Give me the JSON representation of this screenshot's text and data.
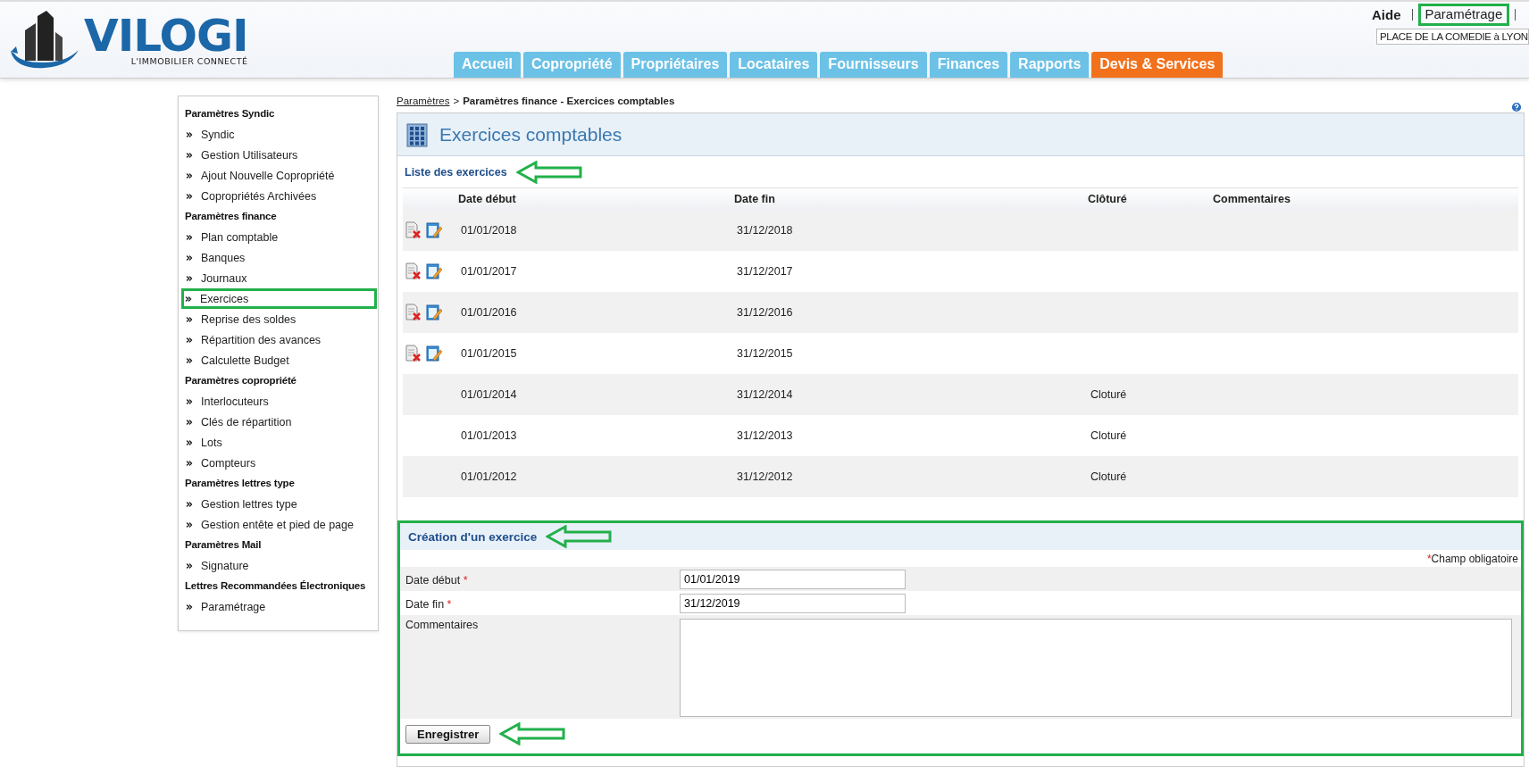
{
  "header": {
    "logo": {
      "name": "VILOGI",
      "tagline": "L'IMMOBILIER CONNECTÉ"
    },
    "nav_tabs": [
      {
        "label": "Accueil",
        "kind": "normal"
      },
      {
        "label": "Copropriété",
        "kind": "normal"
      },
      {
        "label": "Propriétaires",
        "kind": "normal"
      },
      {
        "label": "Locataires",
        "kind": "normal"
      },
      {
        "label": "Fournisseurs",
        "kind": "normal"
      },
      {
        "label": "Finances",
        "kind": "normal"
      },
      {
        "label": "Rapports",
        "kind": "normal"
      },
      {
        "label": "Devis & Services",
        "kind": "accent"
      }
    ],
    "top_links": [
      {
        "label": "Aide",
        "bold": true,
        "highlighted": false
      },
      {
        "label": "Paramétrage",
        "bold": false,
        "highlighted": true
      }
    ],
    "location_field": {
      "value": "PLACE DE LA COMEDIE à LYON"
    }
  },
  "sidebar": {
    "sections": [
      {
        "title": "Paramètres Syndic",
        "items": [
          {
            "label": "Syndic",
            "highlighted": false
          },
          {
            "label": "Gestion Utilisateurs",
            "highlighted": false
          },
          {
            "label": "Ajout Nouvelle Copropriété",
            "highlighted": false
          },
          {
            "label": "Copropriétés Archivées",
            "highlighted": false
          }
        ]
      },
      {
        "title": "Paramètres finance",
        "items": [
          {
            "label": "Plan comptable",
            "highlighted": false
          },
          {
            "label": "Banques",
            "highlighted": false
          },
          {
            "label": "Journaux",
            "highlighted": false
          },
          {
            "label": "Exercices",
            "highlighted": true
          },
          {
            "label": "Reprise des soldes",
            "highlighted": false
          },
          {
            "label": "Répartition des avances",
            "highlighted": false
          },
          {
            "label": "Calculette Budget",
            "highlighted": false
          }
        ]
      },
      {
        "title": "Paramètres copropriété",
        "items": [
          {
            "label": "Interlocuteurs",
            "highlighted": false
          },
          {
            "label": "Clés de répartition",
            "highlighted": false
          },
          {
            "label": "Lots",
            "highlighted": false
          },
          {
            "label": "Compteurs",
            "highlighted": false
          }
        ]
      },
      {
        "title": "Paramètres lettres type",
        "items": [
          {
            "label": "Gestion lettres type",
            "highlighted": false
          },
          {
            "label": "Gestion entête et pied de page",
            "highlighted": false
          }
        ]
      },
      {
        "title": "Paramètres Mail",
        "items": [
          {
            "label": "Signature",
            "highlighted": false
          }
        ]
      },
      {
        "title": "Lettres Recommandées Électroniques",
        "items": [
          {
            "label": "Paramétrage",
            "highlighted": false
          }
        ]
      }
    ]
  },
  "breadcrumb": {
    "link": "Paramètres",
    "separator": ">",
    "current": "Paramètres finance - Exercices comptables"
  },
  "panel": {
    "title": "Exercices comptables",
    "list": {
      "title": "Liste des exercices",
      "arrow": true,
      "columns": [
        "Date début",
        "Date fin",
        "Clôturé",
        "Commentaires"
      ],
      "rows": [
        {
          "start": "01/01/2018",
          "end": "31/12/2018",
          "editable": true
        },
        {
          "start": "01/01/2017",
          "end": "31/12/2017",
          "editable": true
        },
        {
          "start": "01/01/2016",
          "end": "31/12/2016",
          "editable": true
        },
        {
          "start": "01/01/2015",
          "end": "31/12/2015",
          "editable": true
        },
        {
          "start": "01/01/2014",
          "end": "31/12/2014",
          "closed": "Cloturé",
          "editable": false
        },
        {
          "start": "01/01/2013",
          "end": "31/12/2013",
          "closed": "Cloturé",
          "editable": false
        },
        {
          "start": "01/01/2012",
          "end": "31/12/2012",
          "closed": "Cloturé",
          "editable": false
        }
      ]
    },
    "form": {
      "title": "Création d'un exercice",
      "arrow": true,
      "highlighted": true,
      "required_mark": "*",
      "required_note": "Champ obligatoire",
      "fields": [
        {
          "kind": "input",
          "label": "Date début",
          "required": true,
          "value": "01/01/2019"
        },
        {
          "kind": "input",
          "label": "Date fin",
          "required": true,
          "value": "31/12/2019"
        },
        {
          "kind": "textarea",
          "label": "Commentaires",
          "required": false
        }
      ],
      "button": {
        "label": "Enregistrer",
        "arrow": true
      }
    }
  }
}
